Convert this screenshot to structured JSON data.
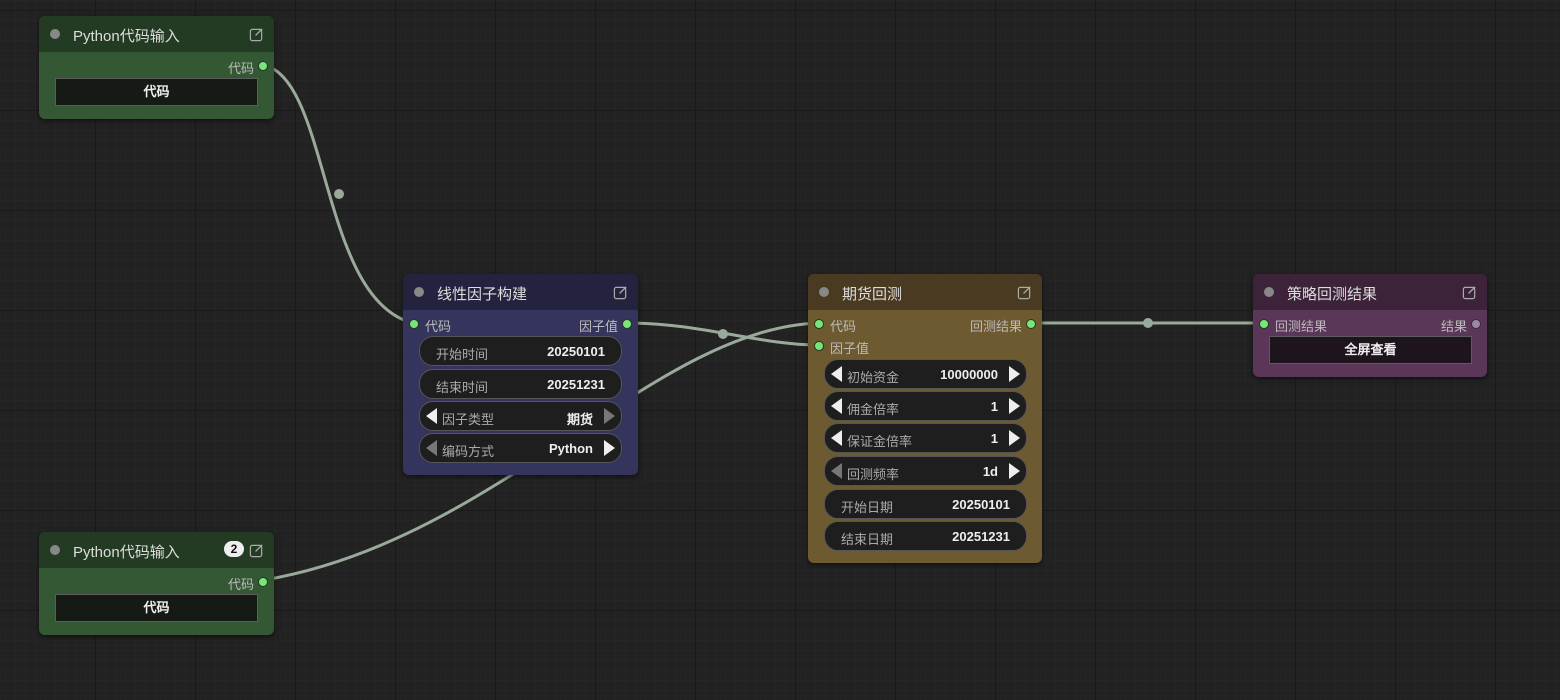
{
  "colors": {
    "canvas_bg": "#222222",
    "link": "#9aaa9a",
    "slot_connected": "#7be37b",
    "python_node_body": "#355834",
    "python_node_header": "#233a23",
    "factor_node_body": "#35345c",
    "factor_node_header": "#24233f",
    "futures_node_body": "#6e5a30",
    "futures_node_header": "#4a3a22",
    "result_node_body": "#5a3658",
    "result_node_header": "#3c2339"
  },
  "nodes": {
    "python_input_1": {
      "title": "Python代码输入",
      "output_label": "代码",
      "button_label": "代码",
      "icon": "edit-icon"
    },
    "python_input_2": {
      "title": "Python代码输入",
      "badge": "2",
      "output_label": "代码",
      "button_label": "代码",
      "icon": "edit-icon"
    },
    "linear_factor": {
      "title": "线性因子构建",
      "input_label": "代码",
      "output_label": "因子值",
      "widgets": [
        {
          "label": "开始时间",
          "value": "20250101"
        },
        {
          "label": "结束时间",
          "value": "20251231"
        },
        {
          "label": "因子类型",
          "value": "期货"
        },
        {
          "label": "编码方式",
          "value": "Python"
        }
      ]
    },
    "futures_backtest": {
      "title": "期货回测",
      "inputs": [
        "代码",
        "因子值"
      ],
      "output_label": "回测结果",
      "widgets": [
        {
          "label": "初始资金",
          "value": "10000000"
        },
        {
          "label": "佣金倍率",
          "value": "1"
        },
        {
          "label": "保证金倍率",
          "value": "1"
        },
        {
          "label": "回测频率",
          "value": "1d"
        },
        {
          "label": "开始日期",
          "value": "20250101"
        },
        {
          "label": "结束日期",
          "value": "20251231"
        }
      ]
    },
    "strategy_result": {
      "title": "策略回测结果",
      "input_label": "回测结果",
      "output_label": "结果",
      "button_label": "全屏查看"
    }
  }
}
